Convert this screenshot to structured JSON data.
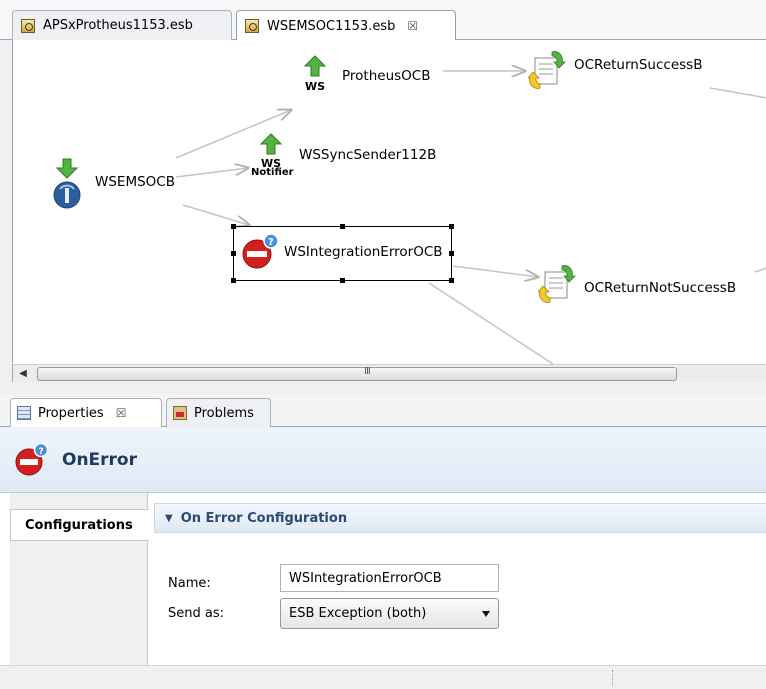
{
  "editor": {
    "tabs": [
      {
        "label": "APSxProtheus1153.esb",
        "active": false
      },
      {
        "label": "WSEMSOC1153.esb",
        "active": true,
        "close": "☒"
      }
    ]
  },
  "canvas": {
    "nodes": {
      "wsemsocb": {
        "label": "WSEMSOCB",
        "icon": "service-start-icon"
      },
      "protheus": {
        "label": "ProtheusOCB",
        "badge": "WS",
        "icon": "ws-send-icon"
      },
      "syncsender": {
        "label": "WSSyncSender112B",
        "badge": "WS",
        "badge2": "Notifier",
        "icon": "ws-notifier-icon"
      },
      "integration_error": {
        "label": "WSIntegrationErrorOCB",
        "icon": "error-icon",
        "selected": true
      },
      "return_success": {
        "label": "OCReturnSuccessB",
        "icon": "return-doc-icon"
      },
      "return_not_success": {
        "label": "OCReturnNotSuccessB",
        "icon": "return-doc-icon"
      }
    },
    "scrollbar_grip": "III"
  },
  "properties": {
    "tabs": [
      {
        "label": "Properties",
        "close": "☒",
        "active": true
      },
      {
        "label": "Problems",
        "active": false
      }
    ],
    "header_title": "OnError",
    "sidebar_item": "Configurations",
    "section_title": "On Error Configuration",
    "fields": {
      "name_label": "Name:",
      "name_value": "WSIntegrationErrorOCB",
      "sendas_label": "Send as:",
      "sendas_value": "ESB Exception (both)"
    }
  },
  "colors": {
    "accent": "#1f3a5f",
    "edge": "#b8b8b8",
    "error_red": "#d3201f",
    "ws_green": "#48b43a"
  }
}
